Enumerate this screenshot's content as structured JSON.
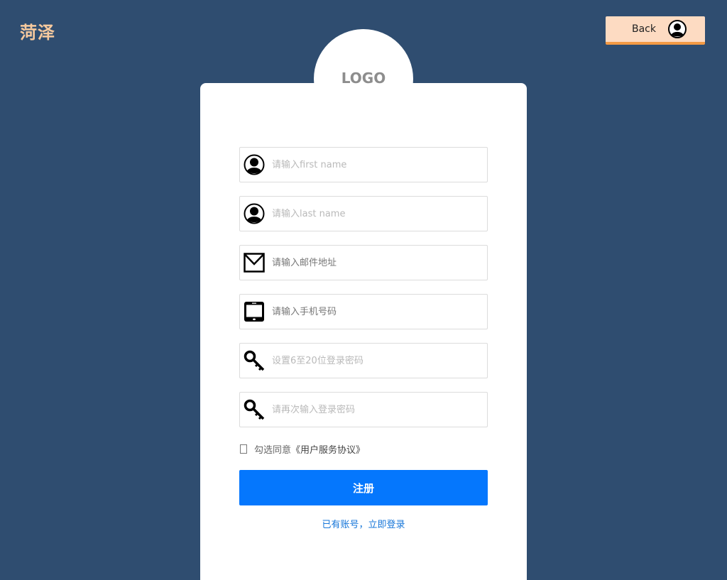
{
  "brand": {
    "name": "菏泽",
    "color": "#f6c99e"
  },
  "header": {
    "back_label": "Back",
    "back_icon": "user-avatar-icon"
  },
  "logo": {
    "text": "LOGO"
  },
  "form": {
    "fields": [
      {
        "name": "first-name",
        "icon": "user-icon",
        "placeholder": "请输入first name",
        "value": ""
      },
      {
        "name": "last-name",
        "icon": "user-icon",
        "placeholder": "请输入last name",
        "value": ""
      },
      {
        "name": "email",
        "icon": "envelope-icon",
        "placeholder": "请输入邮件地址",
        "value": ""
      },
      {
        "name": "phone",
        "icon": "tablet-icon",
        "placeholder": "请输入手机号码",
        "value": ""
      },
      {
        "name": "password",
        "icon": "key-icon",
        "placeholder": "设置6至20位登录密码",
        "value": ""
      },
      {
        "name": "confirm-password",
        "icon": "key-icon",
        "placeholder": "请再次输入登录密码",
        "value": ""
      }
    ],
    "agree_text": "勾选同意",
    "agree_link": "《用户服务协议》",
    "agree_checked": false,
    "submit_label": "注册",
    "login_link": "已有账号，立即登录"
  },
  "colors": {
    "background": "#2f4d70",
    "accent": "#0577fd",
    "back_button": "#fddbc2",
    "back_button_border": "#f39a45"
  }
}
